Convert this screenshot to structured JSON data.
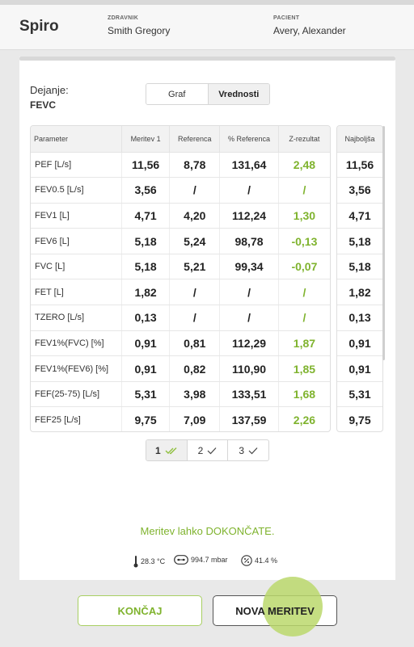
{
  "header": {
    "app_title": "Spiro",
    "doctor_label": "ZDRAVNIK",
    "doctor_name": "Smith Gregory",
    "patient_label": "PACIENT",
    "patient_name": "Avery, Alexander"
  },
  "maneuver": {
    "label": "Dejanje:",
    "value": "FEVC"
  },
  "view_toggle": {
    "graph_label": "Graf",
    "values_label": "Vrednosti",
    "selected": "Vrednosti"
  },
  "table": {
    "headers": [
      "Parameter",
      "Meritev 1",
      "Referenca",
      "% Referenca",
      "Z-rezultat"
    ],
    "best_header": "Najboljša",
    "rows": [
      [
        "PEF [L/s]",
        "11,56",
        "8,78",
        "131,64",
        "2,48",
        "11,56"
      ],
      [
        "FEV0.5 [L/s]",
        "3,56",
        "/",
        "/",
        "/",
        "3,56"
      ],
      [
        "FEV1 [L]",
        "4,71",
        "4,20",
        "112,24",
        "1,30",
        "4,71"
      ],
      [
        "FEV6 [L]",
        "5,18",
        "5,24",
        "98,78",
        "-0,13",
        "5,18"
      ],
      [
        "FVC [L]",
        "5,18",
        "5,21",
        "99,34",
        "-0,07",
        "5,18"
      ],
      [
        "FET [L]",
        "1,82",
        "/",
        "/",
        "/",
        "1,82"
      ],
      [
        "TZERO [L/s]",
        "0,13",
        "/",
        "/",
        "/",
        "0,13"
      ],
      [
        "FEV1%(FVC) [%]",
        "0,91",
        "0,81",
        "112,29",
        "1,87",
        "0,91"
      ],
      [
        "FEV1%(FEV6) [%]",
        "0,91",
        "0,82",
        "110,90",
        "1,85",
        "0,91"
      ],
      [
        "FEF(25-75) [L/s]",
        "5,31",
        "3,98",
        "133,51",
        "1,68",
        "5,31"
      ],
      [
        "FEF25 [L/s]",
        "9,75",
        "7,09",
        "137,59",
        "2,26",
        "9,75"
      ]
    ]
  },
  "measurements": [
    {
      "number": "1",
      "active": true
    },
    {
      "number": "2",
      "active": false
    },
    {
      "number": "3",
      "active": false
    }
  ],
  "status_message": "Meritev lahko DOKONČATE.",
  "environment": {
    "temperature": "28.3 °C",
    "pressure": "994.7 mbar",
    "humidity": "41.4 %"
  },
  "buttons": {
    "finish": "KONČAJ",
    "new_measurement": "NOVA MERITEV"
  },
  "colors": {
    "accent": "#7fb32e",
    "touch_indicator": "#bbd86c"
  }
}
